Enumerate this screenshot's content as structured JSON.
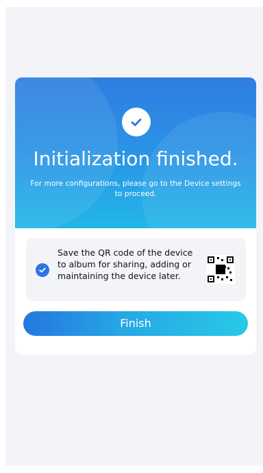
{
  "dialog": {
    "title": "Initialization finished.",
    "subtitle": "For more configurations, please go to the Device settings to proceed.",
    "success_icon": "check-icon",
    "qr_option": {
      "checked": true,
      "text": "Save the QR code of the device to album for sharing, adding or maintaining the device later.",
      "icon": "qr-code-icon"
    },
    "finish_label": "Finish"
  },
  "colors": {
    "accent_blue": "#2D74E5",
    "header_top": "#2F7DE0",
    "header_bottom": "#22B7E8",
    "button_start": "#2577DE",
    "button_end": "#28C9E7",
    "panel_background": "#F3F4F8"
  }
}
